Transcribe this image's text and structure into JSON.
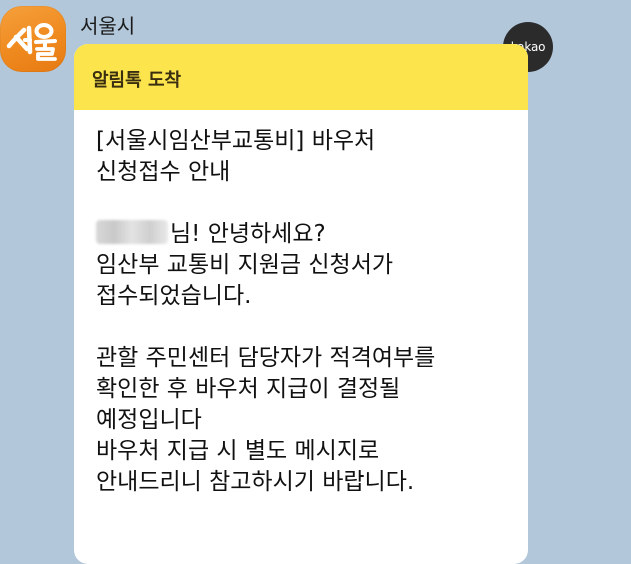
{
  "chat": {
    "sender": {
      "name": "서울시",
      "avatar_logo_text": "서울",
      "avatar_color": "#ef8a1f"
    },
    "channel_badge": "kakao",
    "message": {
      "header_title": "알림톡 도착",
      "header_color": "#fce54c",
      "line1": "[서울시임산부교통비] 바우처",
      "line2": "신청접수 안내",
      "greeting": "님! 안녕하세요?",
      "line4": "임산부 교통비 지원금 신청서가",
      "line5": "접수되었습니다.",
      "line6": "관할 주민센터 담당자가 적격여부를",
      "line7": "확인한 후 바우처 지급이 결정될",
      "line8": "예정입니다",
      "line9": "바우처 지급 시 별도 메시지로",
      "line10": "안내드리니 참고하시기 바랍니다."
    }
  }
}
